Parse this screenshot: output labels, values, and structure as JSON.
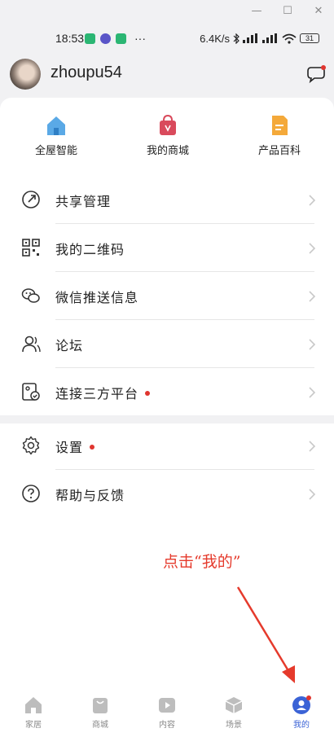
{
  "status": {
    "time": "18:53",
    "dots": "···",
    "speed": "6.4K/s",
    "battery": "31"
  },
  "profile": {
    "username": "zhoupu54"
  },
  "shortcuts": [
    {
      "label": "全屋智能",
      "icon": "home-icon"
    },
    {
      "label": "我的商城",
      "icon": "shopping-bag-icon"
    },
    {
      "label": "产品百科",
      "icon": "document-icon"
    }
  ],
  "menu": {
    "share_manage": "共享管理",
    "qr_code": "我的二维码",
    "wechat_push": "微信推送信息",
    "forum": "论坛",
    "third_party": "连接三方平台",
    "settings": "设置",
    "help": "帮助与反馈"
  },
  "annotation": "点击“我的”",
  "tabs": [
    {
      "label": "家居",
      "icon": "home-icon"
    },
    {
      "label": "商城",
      "icon": "bag-icon"
    },
    {
      "label": "内容",
      "icon": "play-icon"
    },
    {
      "label": "场景",
      "icon": "cube-icon"
    },
    {
      "label": "我的",
      "icon": "user-icon"
    }
  ],
  "colors": {
    "accent": "#3b63d6",
    "badge": "#e0352f",
    "annotation": "#e53a2c"
  }
}
